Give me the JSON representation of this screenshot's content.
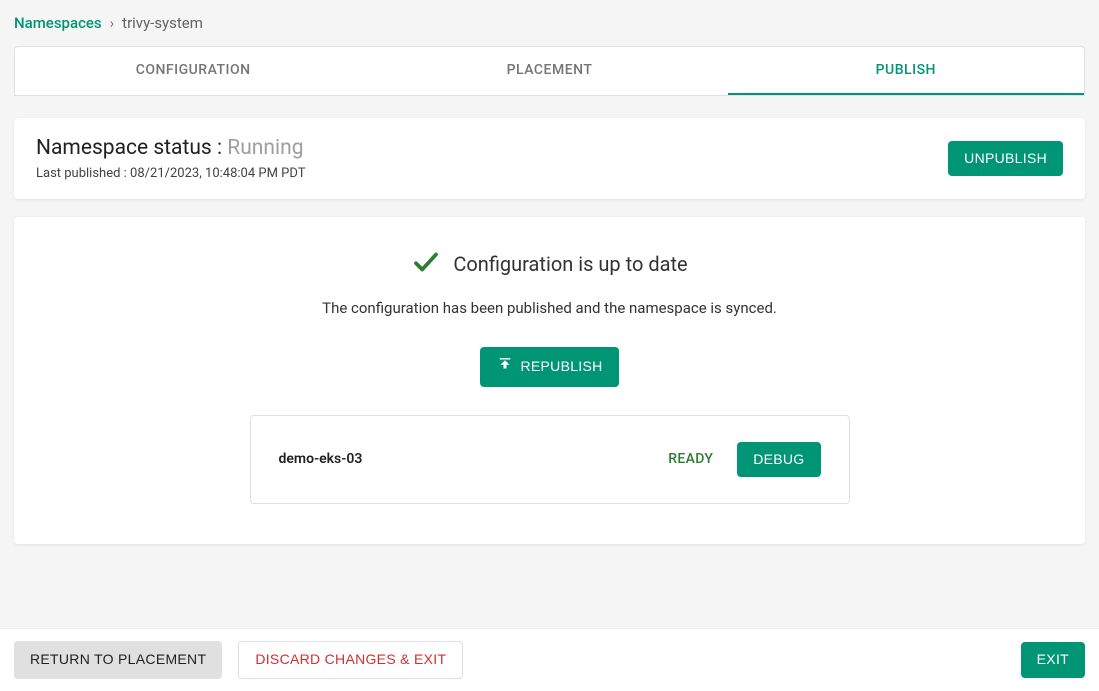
{
  "breadcrumb": {
    "root": "Namespaces",
    "separator": "›",
    "current": "trivy-system"
  },
  "tabs": [
    {
      "label": "CONFIGURATION",
      "active": false
    },
    {
      "label": "PLACEMENT",
      "active": false
    },
    {
      "label": "PUBLISH",
      "active": true
    }
  ],
  "status": {
    "prefix": "Namespace status : ",
    "value": "Running",
    "last_published_label": "Last published : ",
    "last_published_value": "08/21/2023, 10:48:04 PM PDT"
  },
  "actions": {
    "unpublish": "UNPUBLISH",
    "republish": "REPUBLISH",
    "debug": "DEBUG",
    "return_to_placement": "RETURN TO PLACEMENT",
    "discard_exit": "DISCARD CHANGES & EXIT",
    "exit": "EXIT"
  },
  "config": {
    "title": "Configuration is up to date",
    "subtitle": "The configuration has been published and the namespace is synced."
  },
  "cluster": {
    "name": "demo-eks-03",
    "status": "READY"
  },
  "colors": {
    "accent": "#009574",
    "success": "#2e7d32",
    "danger": "#d32f2f"
  }
}
